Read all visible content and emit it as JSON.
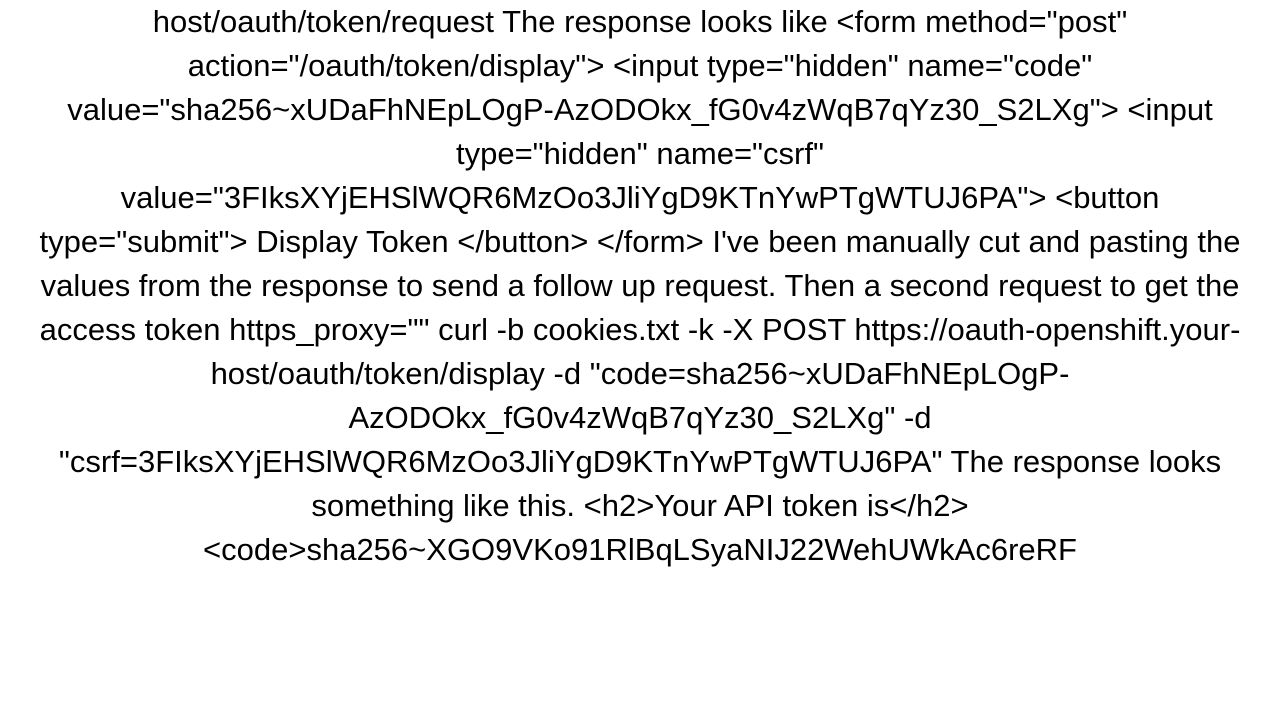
{
  "body_text": "host/oauth/token/request  The response looks like   <form method=\"post\" action=\"/oauth/token/display\">     <input type=\"hidden\" name=\"code\" value=\"sha256~xUDaFhNEpLOgP-AzODOkx_fG0v4zWqB7qYz30_S2LXg\">     <input type=\"hidden\" name=\"csrf\" value=\"3FIksXYjEHSlWQR6MzOo3JliYgD9KTnYwPTgWTUJ6PA\">     <button type=\"submit\">       Display Token     </button>   </form>    I've been manually cut and pasting the values from the response to send a follow up request. Then a second request to get the access token https_proxy=\"\" curl -b cookies.txt -k -X POST https://oauth-openshift.your-host/oauth/token/display -d \"code=sha256~xUDaFhNEpLOgP-AzODOkx_fG0v4zWqB7qYz30_S2LXg\" -d \"csrf=3FIksXYjEHSlWQR6MzOo3JliYgD9KTnYwPTgWTUJ6PA\"  The response looks something like this. <h2>Your API token is</h2>     <code>sha256~XGO9VKo91RlBqLSyaNIJ22WehUWkAc6reRF"
}
